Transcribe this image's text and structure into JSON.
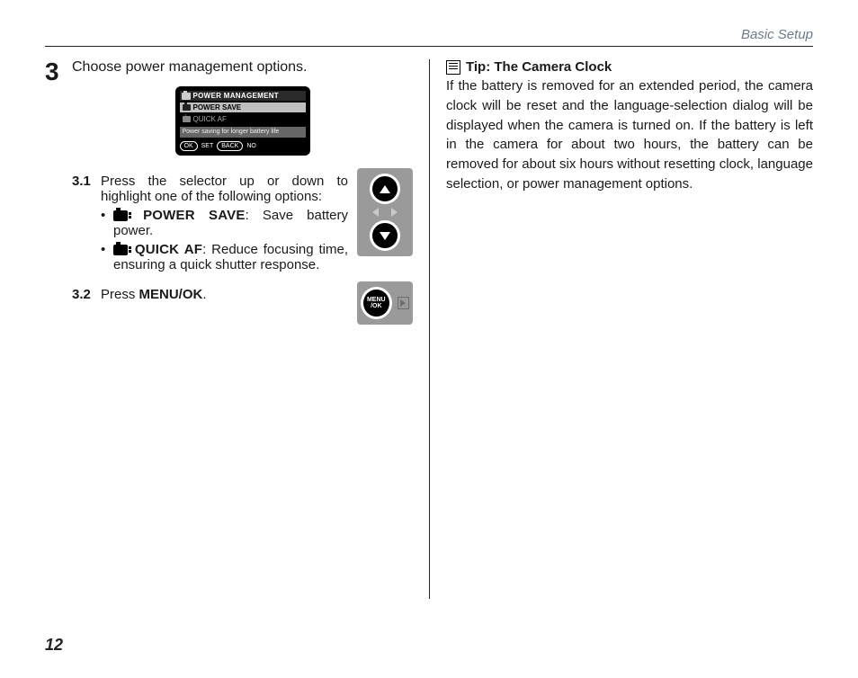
{
  "header": {
    "section": "Basic Setup"
  },
  "page_number": "12",
  "step": {
    "number": "3",
    "title": "Choose power management options.",
    "lcd": {
      "title": "POWER MANAGEMENT",
      "option1": "POWER SAVE",
      "option2": "QUICK AF",
      "description": "Power saving for longer battery life",
      "foot_ok": "OK",
      "foot_set": "SET",
      "foot_back": "BACK",
      "foot_no": "NO"
    },
    "sub1": {
      "num": "3.1",
      "text": "Press the selector up or down to highlight one of the following options:",
      "bullet1": {
        "term": "POWER SAVE",
        "rest": ": Save battery power."
      },
      "bullet2": {
        "term": "QUICK AF",
        "rest": ": Reduce focusing time, ensuring a quick shutter response."
      }
    },
    "sub2": {
      "num": "3.2",
      "text_prefix": "Press ",
      "text_bold": "MENU/OK",
      "text_suffix": "."
    },
    "menuok_label": "MENU\n/OK"
  },
  "tip": {
    "title": "Tip: The Camera Clock",
    "body": "If the battery is removed for an extended period, the camera clock will be reset and the language-selection dialog will be displayed when the camera is turned on.  If the battery is left in the camera for about two hours, the battery can be removed for about six hours without resetting clock, language selection, or power management options."
  }
}
